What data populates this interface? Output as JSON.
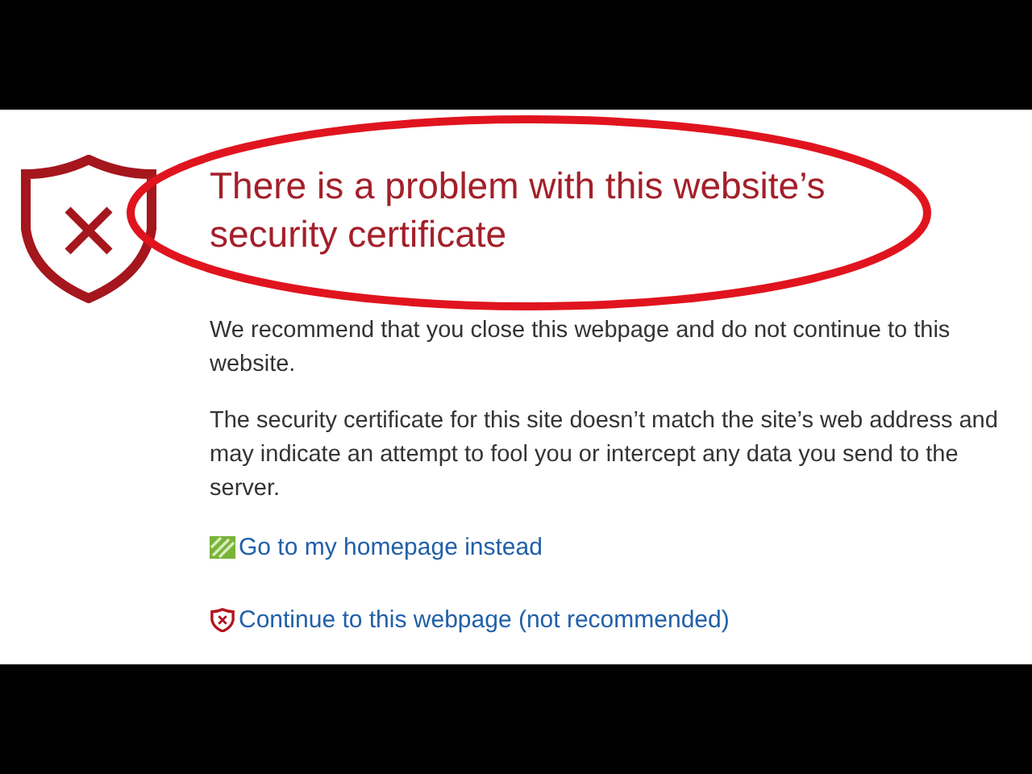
{
  "title": "There is a problem with this website’s security certificate",
  "paragraphs": [
    "We recommend that you close this webpage and do not continue to this website.",
    "The security certificate for this site doesn’t match the site’s web address and may indicate an attempt to fool you or intercept any data you send to the server."
  ],
  "links": [
    {
      "kind": "home",
      "label": "Go to my homepage instead"
    },
    {
      "kind": "continue",
      "label": "Continue to this webpage (not recommended)"
    }
  ]
}
